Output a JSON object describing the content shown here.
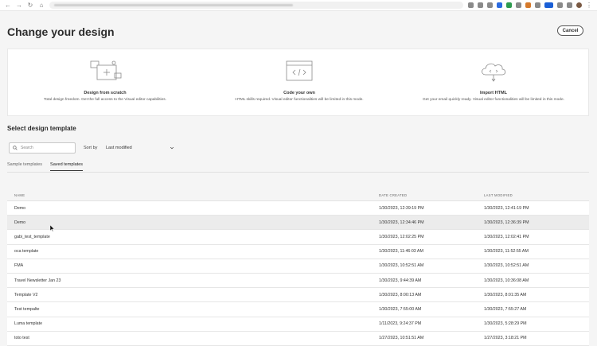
{
  "page": {
    "title": "Change your design",
    "cancel_label": "Cancel"
  },
  "modes": [
    {
      "title": "Design from scratch",
      "desc": "Total design freedom. Get the full access to the Visual editor capabilities.",
      "icon": "design-canvas-icon"
    },
    {
      "title": "Code your own",
      "desc": "HTML skills required. Visual editor functionalities will be limited in this mode.",
      "icon": "code-window-icon"
    },
    {
      "title": "Import HTML",
      "desc": "Get your email quickly ready. Visual editor functionalities will be limited in this mode.",
      "icon": "cloud-upload-icon"
    }
  ],
  "templates": {
    "section_title": "Select design template",
    "search_placeholder": "Search",
    "sort_label": "Sort by",
    "sort_value": "Last modified",
    "tabs": [
      "Sample templates",
      "Saved templates"
    ],
    "active_tab": "Saved templates",
    "columns": {
      "name": "NAME",
      "created": "DATE CREATED",
      "modified": "LAST MODIFIED"
    },
    "rows": [
      {
        "name": "Demo",
        "created": "1/30/2023, 12:39:19 PM",
        "modified": "1/30/2023, 12:41:19 PM"
      },
      {
        "name": "Demo",
        "created": "1/30/2023, 12:34:46 PM",
        "modified": "1/30/2023, 12:36:39 PM"
      },
      {
        "name": "gabi_test_template",
        "created": "1/30/2023, 12:02:25 PM",
        "modified": "1/30/2023, 12:02:41 PM"
      },
      {
        "name": "oca template",
        "created": "1/30/2023, 11:46:03 AM",
        "modified": "1/30/2023, 11:52:55 AM"
      },
      {
        "name": "FMA",
        "created": "1/30/2023, 10:52:51 AM",
        "modified": "1/30/2023, 10:52:51 AM"
      },
      {
        "name": "Travel Newsletter Jan 23",
        "created": "1/30/2023, 9:44:39 AM",
        "modified": "1/30/2023, 10:36:08 AM"
      },
      {
        "name": "Template V2",
        "created": "1/30/2023, 8:00:13 AM",
        "modified": "1/30/2023, 8:01:35 AM"
      },
      {
        "name": "Test tempalte",
        "created": "1/30/2023, 7:55:00 AM",
        "modified": "1/30/2023, 7:55:27 AM"
      },
      {
        "name": "Luma template",
        "created": "1/11/2023, 9:24:37 PM",
        "modified": "1/30/2023, 5:28:29 PM"
      },
      {
        "name": "toto test",
        "created": "1/27/2023, 10:51:51 AM",
        "modified": "1/27/2023, 3:18:21 PM"
      }
    ]
  },
  "colors": {
    "background": "#f5f5f5",
    "panel": "#ffffff",
    "row_hover": "#ececec",
    "text": "#2c2c2c"
  }
}
